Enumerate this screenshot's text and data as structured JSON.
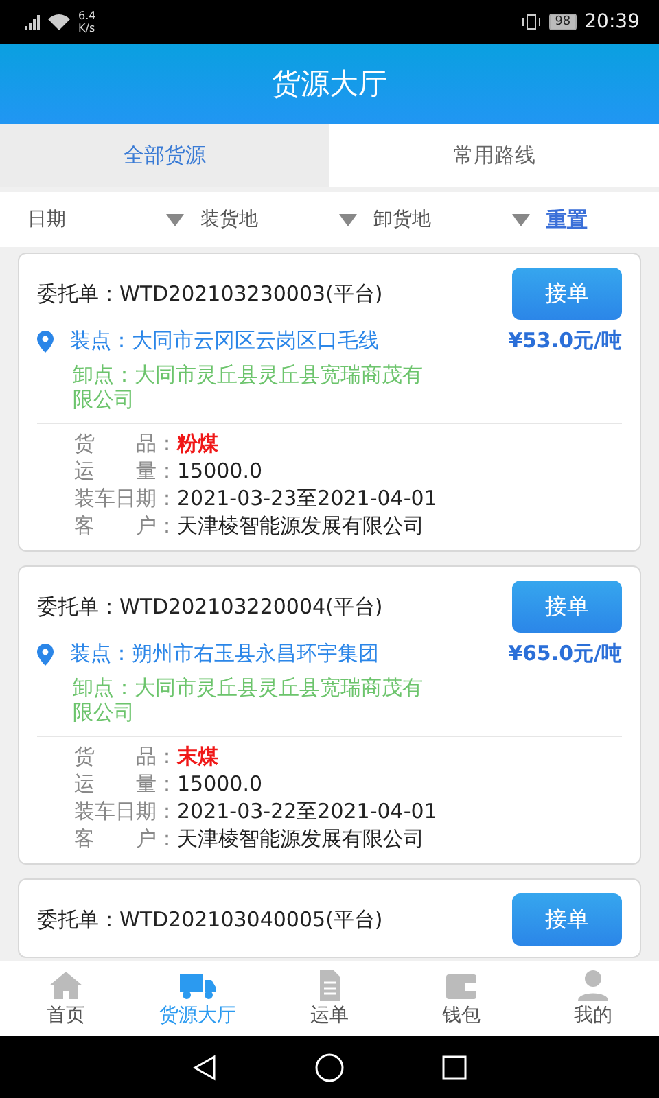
{
  "status_bar": {
    "speed": "6.4",
    "speed_unit": "K/s",
    "battery": "98",
    "time": "20:39"
  },
  "header": {
    "title": "货源大厅"
  },
  "tabs": [
    {
      "label": "全部货源",
      "selected": true
    },
    {
      "label": "常用路线",
      "selected": false
    }
  ],
  "filters": [
    {
      "label": "日期"
    },
    {
      "label": "装货地"
    },
    {
      "label": "卸货地"
    }
  ],
  "reset": "重置",
  "orders": [
    {
      "order_no": "委托单：WTD202103230003(平台)",
      "action": "接单",
      "load": "装点：大同市云冈区云岗区口毛线",
      "price": "¥53.0元/吨",
      "unload": "卸点：大同市灵丘县灵丘县宽瑞商茂有限公司",
      "details": [
        {
          "label": "货　　品：",
          "value": "粉煤",
          "kind": "highlight"
        },
        {
          "label": "运　　量：",
          "value": "15000.0",
          "kind": "plain"
        },
        {
          "label": "装车日期：",
          "value": "2021-03-23至2021-04-01",
          "kind": "plain"
        },
        {
          "label": "客　　户：",
          "value": "天津棱智能源发展有限公司",
          "kind": "plain"
        }
      ]
    },
    {
      "order_no": "委托单：WTD202103220004(平台)",
      "action": "接单",
      "load": "装点：朔州市右玉县永昌环宇集团",
      "price": "¥65.0元/吨",
      "unload": "卸点：大同市灵丘县灵丘县宽瑞商茂有限公司",
      "details": [
        {
          "label": "货　　品：",
          "value": "末煤",
          "kind": "highlight"
        },
        {
          "label": "运　　量：",
          "value": "15000.0",
          "kind": "plain"
        },
        {
          "label": "装车日期：",
          "value": "2021-03-22至2021-04-01",
          "kind": "plain"
        },
        {
          "label": "客　　户：",
          "value": "天津棱智能源发展有限公司",
          "kind": "plain"
        }
      ]
    },
    {
      "order_no": "委托单：WTD202103040005(平台)",
      "action": "接单"
    }
  ],
  "bottom_nav": [
    {
      "label": "首页",
      "kind": "home",
      "selected": false
    },
    {
      "label": "货源大厅",
      "kind": "truck",
      "selected": true
    },
    {
      "label": "运单",
      "kind": "doc",
      "selected": false
    },
    {
      "label": "钱包",
      "kind": "wallet",
      "selected": false
    },
    {
      "label": "我的",
      "kind": "user",
      "selected": false
    }
  ]
}
